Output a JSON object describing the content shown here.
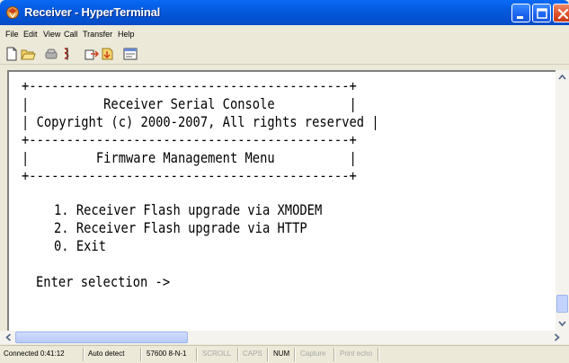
{
  "window": {
    "title": "Receiver - HyperTerminal"
  },
  "menu": {
    "items": [
      "File",
      "Edit",
      "View",
      "Call",
      "Transfer",
      "Help"
    ]
  },
  "toolbar": {
    "icons": [
      "new-icon",
      "open-icon",
      "phone-icon",
      "disconnect-icon",
      "send-icon",
      "receive-icon",
      "properties-icon"
    ]
  },
  "terminal": {
    "banner_border": "+-------------------------------------------+",
    "banner_line1": "|          Receiver Serial Console          |",
    "banner_line2": "| Copyright (c) 2000-2007, All rights reserved |",
    "menu_border": "+-------------------------------------------+",
    "menu_title": "|         Firmware Management Menu          |",
    "menu_border_bottom": "+-------------------------------------------+",
    "options": [
      "1. Receiver Flash upgrade via XMODEM",
      "2. Receiver Flash upgrade via HTTP",
      "0. Exit"
    ],
    "prompt": "Enter selection ->"
  },
  "status": {
    "connected": "Connected 0:41:12",
    "detect": "Auto detect",
    "port_settings": "57600 8-N-1",
    "scroll": "SCROLL",
    "caps": "CAPS",
    "num": "NUM",
    "capture": "Capture",
    "print_echo": "Print echo"
  },
  "colors": {
    "titlebar": "#0458dc",
    "chrome": "#ece9d8",
    "terminal_bg": "#ffffff",
    "terminal_text": "#000000"
  }
}
